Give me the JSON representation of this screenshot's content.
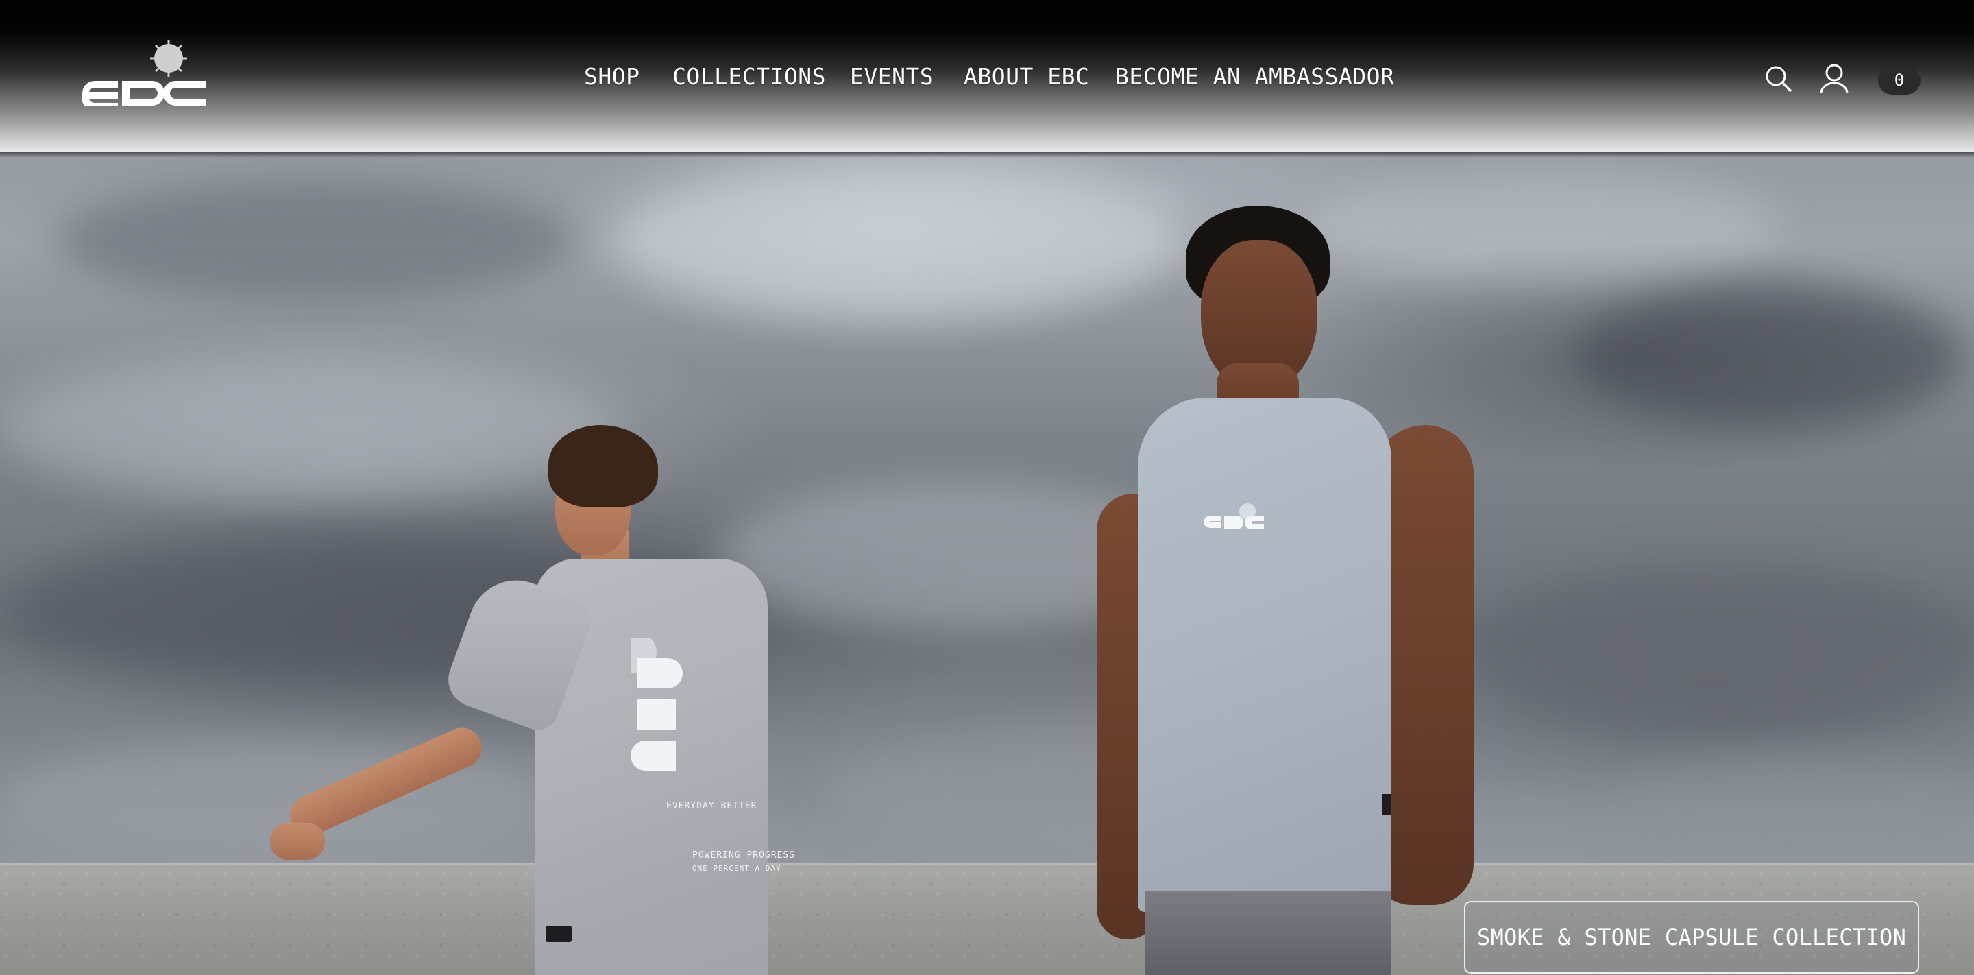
{
  "header": {
    "logo_alt": "EBC",
    "nav": [
      {
        "label": "SHOP"
      },
      {
        "label": "COLLECTIONS"
      },
      {
        "label": "EVENTS"
      },
      {
        "label": "ABOUT EBC"
      },
      {
        "label": "BECOME AN AMBASSADOR"
      }
    ],
    "icons": {
      "search": "search-icon",
      "account": "user-icon",
      "cart": "cart-icon"
    },
    "cart_count": "0"
  },
  "hero": {
    "cta_label": "SMOKE & STONE CAPSULE COLLECTION",
    "tee_print": {
      "tagline": "EVERYDAY BETTER",
      "line1": "POWERING PROGRESS",
      "line2": "ONE PERCENT A DAY"
    }
  },
  "colors": {
    "header_top": "#000000",
    "header_bottom": "#e9e9e9",
    "nav_text": "#ffffff",
    "cart_badge": "#2a2a2a"
  }
}
